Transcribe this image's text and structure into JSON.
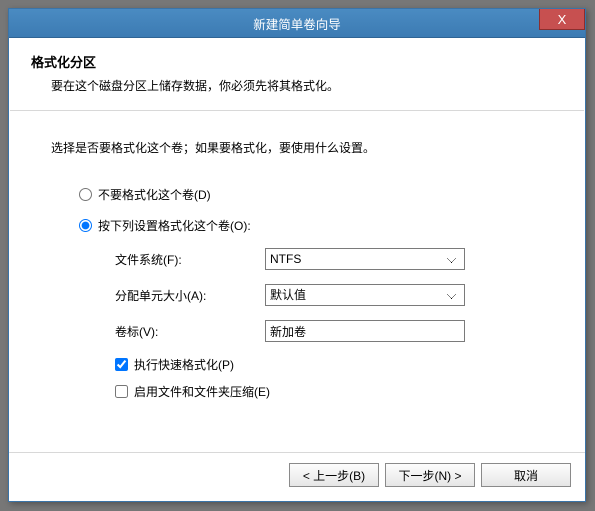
{
  "titlebar": {
    "title": "新建简单卷向导",
    "close": "X"
  },
  "header": {
    "title": "格式化分区",
    "subtitle": "要在这个磁盘分区上储存数据，你必须先将其格式化。"
  },
  "instruction": "选择是否要格式化这个卷；如果要格式化，要使用什么设置。",
  "radios": {
    "noformat": "不要格式化这个卷(D)",
    "format": "按下列设置格式化这个卷(O):"
  },
  "fields": {
    "filesystem_label": "文件系统(F):",
    "filesystem_value": "NTFS",
    "alloc_label": "分配单元大小(A):",
    "alloc_value": "默认值",
    "volume_label_label": "卷标(V):",
    "volume_label_value": "新加卷"
  },
  "checkboxes": {
    "quick": "执行快速格式化(P)",
    "compress": "启用文件和文件夹压缩(E)"
  },
  "buttons": {
    "back": "< 上一步(B)",
    "next": "下一步(N) >",
    "cancel": "取消"
  }
}
